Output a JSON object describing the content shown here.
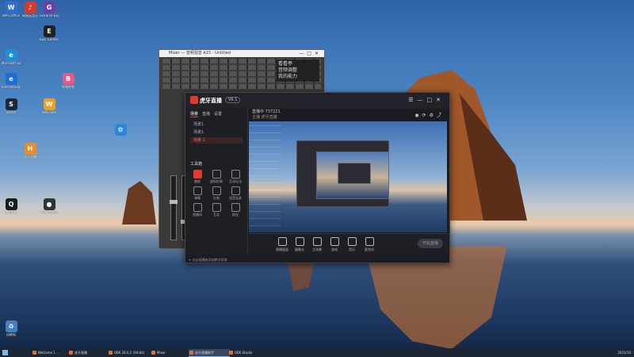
{
  "desktop": {
    "icons": [
      {
        "label": "WPS Office",
        "icon": "wps-icon",
        "color": "#2d6fd6",
        "glyph": "W"
      },
      {
        "label": "网易云音乐",
        "icon": "music-icon",
        "color": "#d63a2d",
        "glyph": "♪"
      },
      {
        "label": "GeForce Experience",
        "icon": "geforce-icon",
        "color": "#6a3fa8",
        "glyph": "G"
      },
      {
        "label": "",
        "icon": "app-icon",
        "color": "#2a86d6",
        "glyph": "⚙"
      },
      {
        "label": "Microsoft Edge",
        "icon": "edge-icon",
        "color": "#1d8fd6",
        "glyph": "e"
      },
      {
        "label": "Epic Games Launcher",
        "icon": "epic-icon",
        "color": "#222",
        "glyph": "E"
      },
      {
        "label": "Internet Explorer",
        "icon": "ie-icon",
        "color": "#1d6fd6",
        "glyph": "e"
      },
      {
        "label": "Steam",
        "icon": "steam-icon",
        "color": "#1b2838",
        "glyph": "S"
      },
      {
        "label": "WeGame",
        "icon": "wegame-icon",
        "color": "#f0a020",
        "glyph": "W"
      },
      {
        "label": "哔哩哔哩",
        "icon": "bilibili-icon",
        "color": "#e05a8a",
        "glyph": "B"
      },
      {
        "label": "腾讯QQ",
        "icon": "qq-icon",
        "color": "#1a1a1a",
        "glyph": "Q"
      },
      {
        "label": "OBS Studio",
        "icon": "obs-icon",
        "color": "#333",
        "glyph": "●"
      },
      {
        "label": "虎牙直播",
        "icon": "huya-icon",
        "color": "#f08a20",
        "glyph": "H"
      },
      {
        "label": "回收站",
        "icon": "recycle-bin-icon",
        "color": "#4a7fbf",
        "glyph": "♻"
      }
    ]
  },
  "back_window": {
    "title": "Mixer — 音频混音 A15 - Untitled",
    "side_text": [
      "看看亭",
      "音频调整",
      "我的能力"
    ]
  },
  "app": {
    "logo_text": "虎牙直播",
    "version": "V6.1",
    "tabs": [
      "场景",
      "直播",
      "设置"
    ],
    "scenes": [
      "场景1",
      "场景1",
      "场景 1"
    ],
    "stage_title": "直播中 737221",
    "stage_sub": "主播 虎牙直播",
    "tool_title": "工具箱",
    "tools": [
      {
        "label": "美颜"
      },
      {
        "label": "虚拟形象"
      },
      {
        "label": "互动玩法"
      },
      {
        "label": "弹幕"
      },
      {
        "label": "礼物"
      },
      {
        "label": "语音连麦"
      },
      {
        "label": "直播间"
      },
      {
        "label": "互动"
      },
      {
        "label": "粉丝"
      }
    ],
    "hint": "+ 点击直播来添加数字资源",
    "bottom_items": [
      "直播画面",
      "摄像头",
      "主场景",
      "游戏",
      "音乐",
      "麦克风"
    ],
    "start_label": "开始直播"
  },
  "taskbar": {
    "items": [
      "WeGame 1 ...",
      "虎牙直播",
      "OBS 28.0.2 (64-bit)",
      "Mixer",
      "虎牙直播助手",
      "OBS Studio"
    ],
    "tray": "2023/10"
  },
  "colors": {
    "accent": "#e23b2e",
    "taskbar": "#1c2634"
  }
}
